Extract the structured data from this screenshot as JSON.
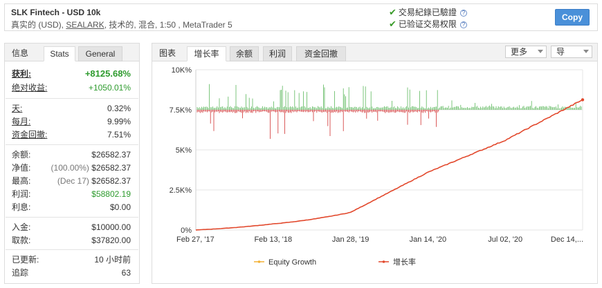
{
  "header": {
    "title": "SLK Fintech - USD 10k",
    "sub_prefix": "真实的 (USD), ",
    "sub_link": "SEALARK",
    "sub_suffix": ", 技术的, 混合, 1:50 , MetaTrader 5",
    "verify_track": "交易紀錄已驗證",
    "verify_privilege": "已验证交易权限",
    "copy_label": "Copy"
  },
  "stats": {
    "tabs": {
      "info": "信息",
      "stats": "Stats",
      "general": "General"
    },
    "rows": {
      "gain": {
        "label": "获利:",
        "value": "+8125.68%"
      },
      "abs_gain": {
        "label": "绝对收益:",
        "value": "+1050.01%"
      },
      "daily": {
        "label": "天:",
        "value": "0.32%"
      },
      "monthly": {
        "label": "每月:",
        "value": "9.99%"
      },
      "drawdown": {
        "label": "资金回撤:",
        "value": "7.51%"
      },
      "balance": {
        "label": "余额:",
        "value": "$26582.37"
      },
      "equity": {
        "label": "净值:",
        "paren": "(100.00%)",
        "value": "$26582.37"
      },
      "highest": {
        "label": "最高:",
        "paren": "(Dec 17)",
        "value": "$26582.37"
      },
      "profit": {
        "label": "利润:",
        "value": "$58802.19"
      },
      "interest": {
        "label": "利息:",
        "value": "$0.00"
      },
      "deposits": {
        "label": "入金:",
        "value": "$10000.00"
      },
      "withdrawals": {
        "label": "取款:",
        "value": "$37820.00"
      },
      "updated": {
        "label": "已更新:",
        "value": "10 小时前"
      },
      "tracking": {
        "label": "追踪",
        "value": "63"
      }
    }
  },
  "chart": {
    "tabs": {
      "chart": "图表",
      "growth": "增长率",
      "balance": "余额",
      "profit": "利润",
      "drawdown": "资金回撤"
    },
    "more_label": "更多",
    "export_label": "导",
    "legend": {
      "equity": "Equity Growth",
      "growth": "增长率"
    },
    "colors": {
      "growth_line": "#e2482c",
      "equity_line": "#f2b134",
      "bar_up": "#5cb85c",
      "bar_down": "#d03030"
    }
  },
  "chart_data": {
    "type": "line",
    "yticks": [
      "10K%",
      "7.5K%",
      "5K%",
      "2.5K%",
      "0%"
    ],
    "ylim": [
      0,
      10000
    ],
    "xticks": [
      "Feb 27, '17",
      "Feb 13, '18",
      "Jan 28, '19",
      "Jan 14, '20",
      "Jul 02, '20",
      "Dec 14,..."
    ],
    "series": [
      {
        "name": "增长率",
        "x": [
          "Feb 27, '17",
          "Feb 13, '18",
          "Jan 28, '19",
          "Jan 14, '20",
          "Jul 02, '20",
          "Dec 14,..."
        ],
        "values": [
          0,
          380,
          1100,
          3600,
          5600,
          8126
        ]
      },
      {
        "name": "Equity Growth",
        "x": [],
        "values": []
      }
    ],
    "grid": true,
    "legend_position": "bottom"
  }
}
